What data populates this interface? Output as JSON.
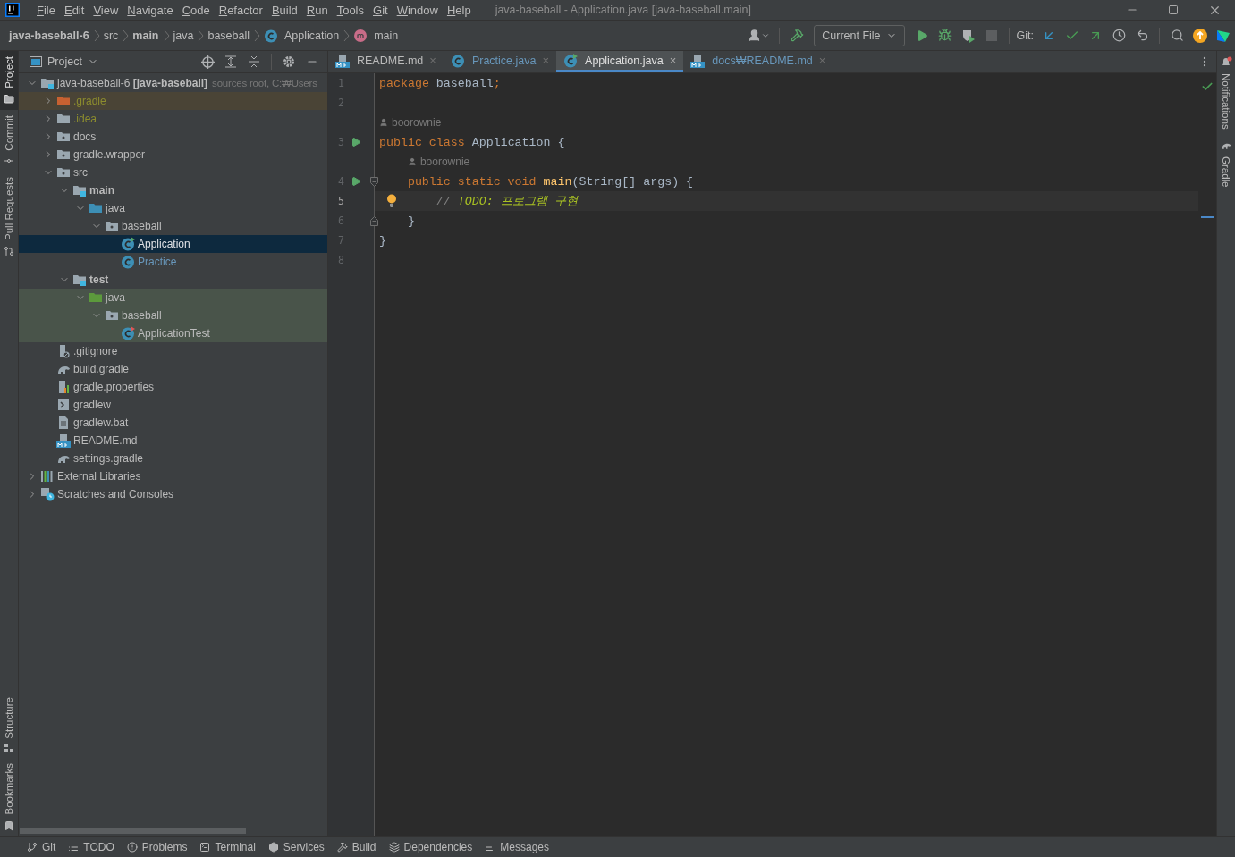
{
  "title_bar": {
    "menu": [
      "File",
      "Edit",
      "View",
      "Navigate",
      "Code",
      "Refactor",
      "Build",
      "Run",
      "Tools",
      "Git",
      "Window",
      "Help"
    ],
    "title": "java-baseball - Application.java [java-baseball.main]"
  },
  "breadcrumbs": [
    {
      "label": "java-baseball-6",
      "bold": true,
      "kind": "plain"
    },
    {
      "label": "src",
      "bold": false,
      "kind": "plain"
    },
    {
      "label": "main",
      "bold": true,
      "kind": "plain"
    },
    {
      "label": "java",
      "bold": false,
      "kind": "plain"
    },
    {
      "label": "baseball",
      "bold": false,
      "kind": "plain"
    },
    {
      "label": "Application",
      "bold": false,
      "kind": "class"
    },
    {
      "label": "main",
      "bold": false,
      "kind": "method"
    }
  ],
  "toolbar": {
    "run_config": "Current File",
    "git_label": "Git:",
    "stop_disabled": true
  },
  "left_tool_windows_top": [
    {
      "label": "Project",
      "kind": "folder",
      "selected": true
    },
    {
      "label": "Commit",
      "kind": "commit",
      "selected": false
    },
    {
      "label": "Pull Requests",
      "kind": "pull",
      "selected": false
    }
  ],
  "left_tool_windows_bottom": [
    {
      "label": "Structure",
      "kind": "structure",
      "selected": false
    },
    {
      "label": "Bookmarks",
      "kind": "bookmark",
      "selected": false
    }
  ],
  "right_tool_windows": [
    {
      "label": "Notifications",
      "kind": "bell",
      "selected": false
    },
    {
      "label": "Gradle",
      "kind": "gradle",
      "selected": false
    }
  ],
  "project_panel": {
    "title": "Project",
    "tree": [
      {
        "name": "java-baseball-6 **[java-baseball]**",
        "hint": "sources root,  C:₩Users",
        "kind": "root",
        "modified": false,
        "selected": false,
        "expanded": true,
        "children": [
          {
            "name": ".gradle",
            "kind": "excluded",
            "modified": false,
            "selected": false,
            "expanded": false
          },
          {
            "name": ".idea",
            "kind": "ignored",
            "modified": false,
            "selected": false,
            "expanded": false
          },
          {
            "name": "docs",
            "kind": "package",
            "modified": false,
            "selected": false,
            "expanded": false
          },
          {
            "name": "gradle.wrapper",
            "kind": "package",
            "modified": false,
            "selected": false,
            "expanded": false
          },
          {
            "name": "src",
            "kind": "package",
            "modified": false,
            "selected": false,
            "expanded": true,
            "children": [
              {
                "name": "main",
                "kind": "module",
                "modified": false,
                "selected": false,
                "expanded": true,
                "children": [
                  {
                    "name": "java",
                    "kind": "sources",
                    "modified": false,
                    "selected": false,
                    "expanded": true,
                    "children": [
                      {
                        "name": "baseball",
                        "kind": "package",
                        "modified": false,
                        "selected": false,
                        "expanded": true,
                        "children": [
                          {
                            "name": "Application",
                            "kind": "mainclass",
                            "modified": false,
                            "selected": true
                          },
                          {
                            "name": "Practice",
                            "kind": "class",
                            "modified": true,
                            "selected": false
                          }
                        ]
                      }
                    ]
                  }
                ]
              },
              {
                "name": "test",
                "kind": "module",
                "modified": false,
                "selected": false,
                "expanded": true,
                "children": [
                  {
                    "name": "java",
                    "kind": "tests",
                    "modified": false,
                    "selected": false,
                    "expanded": true,
                    "children": [
                      {
                        "name": "baseball",
                        "kind": "package",
                        "modified": false,
                        "selected": false,
                        "expanded": true,
                        "children": [
                          {
                            "name": "ApplicationTest",
                            "kind": "testclass",
                            "modified": false,
                            "selected": false
                          }
                        ]
                      }
                    ]
                  }
                ]
              }
            ]
          },
          {
            "name": ".gitignore",
            "kind": "gitignore",
            "modified": false,
            "selected": false
          },
          {
            "name": "build.gradle",
            "kind": "gradle",
            "modified": false,
            "selected": false
          },
          {
            "name": "gradle.properties",
            "kind": "properties",
            "modified": false,
            "selected": false
          },
          {
            "name": "gradlew",
            "kind": "script",
            "modified": false,
            "selected": false
          },
          {
            "name": "gradlew.bat",
            "kind": "text",
            "modified": false,
            "selected": false
          },
          {
            "name": "README.md",
            "kind": "markdown",
            "modified": false,
            "selected": false
          },
          {
            "name": "settings.gradle",
            "kind": "gradle",
            "modified": false,
            "selected": false
          }
        ]
      },
      {
        "name": "External Libraries",
        "kind": "libraries",
        "modified": false,
        "selected": false,
        "expanded": false
      },
      {
        "name": "Scratches and Consoles",
        "kind": "scratches",
        "modified": false,
        "selected": false,
        "expanded": false
      }
    ]
  },
  "tabs": [
    {
      "label": "README.md",
      "kind": "markdown",
      "modified": false,
      "selected": false,
      "close": "×"
    },
    {
      "label": "Practice.java",
      "kind": "class",
      "modified": true,
      "selected": false,
      "close": "×"
    },
    {
      "label": "Application.java",
      "kind": "mainclass",
      "modified": true,
      "selected": true,
      "close": "×"
    },
    {
      "label": "docs₩README.md",
      "kind": "markdown",
      "modified": true,
      "selected": false,
      "close": "×"
    }
  ],
  "editor": {
    "no_problems": true,
    "code_lines": [
      {
        "number": "1",
        "kind": "plain",
        "run": false,
        "current": false,
        "tokens": [
          {
            "kind": "keyword",
            "text": "package"
          },
          {
            "kind": "plain",
            "text": " baseball"
          },
          {
            "kind": "keyword",
            "text": ";"
          }
        ]
      },
      {
        "number": "2",
        "kind": "plain",
        "run": false,
        "current": false
      },
      {
        "number": "3",
        "kind": "plain",
        "run": true,
        "current": false,
        "author": "boorownie",
        "tokens": [
          {
            "kind": "keyword",
            "text": "public class"
          },
          {
            "kind": "plain",
            "text": " Application {"
          }
        ]
      },
      {
        "number": "4",
        "kind": "fold-start",
        "run": true,
        "current": false,
        "author": "boorownie",
        "tokens": [
          {
            "kind": "keyword",
            "text": "    public static void"
          },
          {
            "kind": "function",
            "text": " main"
          },
          {
            "kind": "plain",
            "text": "(String[] args) {"
          }
        ]
      },
      {
        "number": "5",
        "kind": "plain",
        "run": false,
        "current": true,
        "bulb": true,
        "tokens": [
          {
            "kind": "comment",
            "text": "        // "
          },
          {
            "kind": "todo",
            "text": "TODO: 프로그램 구현"
          }
        ]
      },
      {
        "number": "6",
        "kind": "fold-end",
        "run": false,
        "current": false,
        "tokens": [
          {
            "kind": "plain",
            "text": "    }"
          }
        ]
      },
      {
        "number": "7",
        "kind": "plain",
        "run": false,
        "current": false,
        "tokens": [
          {
            "kind": "plain",
            "text": "}"
          }
        ]
      },
      {
        "number": "8",
        "kind": "plain",
        "run": false,
        "current": false
      }
    ]
  },
  "bottom_tools": [
    {
      "label": "Git",
      "kind": "branch"
    },
    {
      "label": "TODO",
      "kind": "list"
    },
    {
      "label": "Problems",
      "kind": "problems"
    },
    {
      "label": "Terminal",
      "kind": "terminal"
    },
    {
      "label": "Services",
      "kind": "services"
    },
    {
      "label": "Build",
      "kind": "hammer"
    },
    {
      "label": "Dependencies",
      "kind": "layers"
    },
    {
      "label": "Messages",
      "kind": "messages"
    }
  ]
}
